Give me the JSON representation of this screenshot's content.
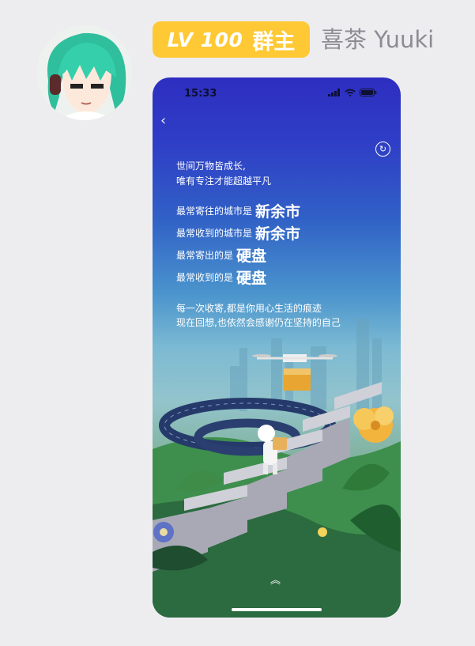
{
  "message": {
    "sender": {
      "level_badge": "LV 100",
      "role_badge": "群主",
      "name": "喜茶 Yuuki",
      "avatar_icon": "anime-avatar"
    },
    "screenshot": {
      "status_bar": {
        "time": "15:33",
        "icons": [
          "signal-icon",
          "wifi-icon",
          "battery-icon"
        ]
      },
      "nav": {
        "back_glyph": "‹",
        "share_icon": "share-icon"
      },
      "slogan": [
        "世间万物皆成长,",
        "唯有专注才能超越平凡"
      ],
      "stats": [
        {
          "label": "最常寄往的城市是",
          "value": "新余市"
        },
        {
          "label": "最常收到的城市是",
          "value": "新余市"
        },
        {
          "label": "最常寄出的是",
          "value": "硬盘"
        },
        {
          "label": "最常收到的是",
          "value": "硬盘"
        }
      ],
      "message_lines": [
        "每一次收寄,都是你用心生活的痕迹",
        "现在回想,也依然会感谢仍在坚持的自己"
      ],
      "swipe_up_glyph": "︽",
      "colors": {
        "badge": "#ffc935",
        "name": "#8c8c92",
        "screen_top": "#2d2ec0"
      }
    }
  }
}
